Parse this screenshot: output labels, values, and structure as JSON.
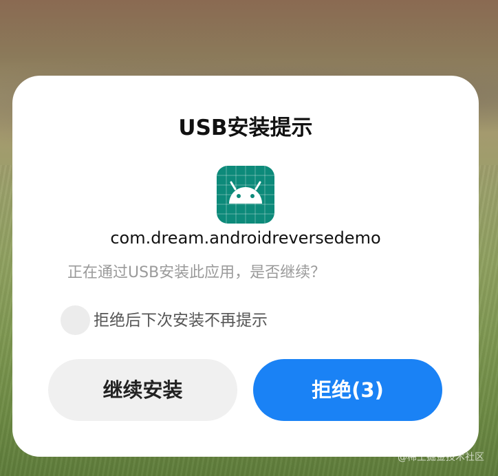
{
  "dialog": {
    "title": "USB安装提示",
    "app_icon": "android-icon",
    "package_name": "com.dream.androidreversedemo",
    "message": "正在通过USB安装此应用，是否继续？",
    "checkbox_label": "拒绝后下次安装不再提示",
    "checkbox_checked": false,
    "continue_label": "继续安装",
    "reject_label": "拒绝(3)"
  },
  "watermark": "@稀土掘金技术社区",
  "colors": {
    "reject_button": "#1a82f5",
    "continue_button": "#f0f0f0",
    "app_icon_bg": "#0d8a7a"
  }
}
